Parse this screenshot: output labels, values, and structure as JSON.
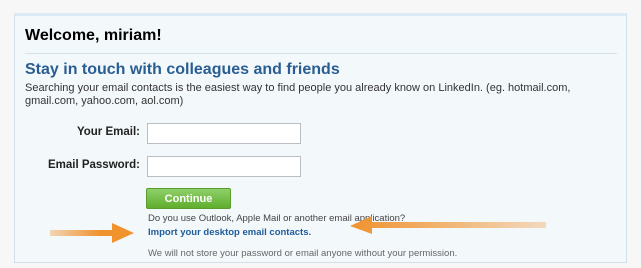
{
  "header": {
    "welcome": "Welcome, miriam!"
  },
  "intro": {
    "headline": "Stay in touch with colleagues and friends",
    "description": "Searching your email contacts is the easiest way to find people you already know on LinkedIn. (eg. hotmail.com, gmail.com, yahoo.com, aol.com)"
  },
  "form": {
    "email_label": "Your Email:",
    "email_value": "",
    "password_label": "Email Password:",
    "password_value": "",
    "continue_label": "Continue"
  },
  "help": {
    "question": "Do you use Outlook, Apple Mail or another email application?",
    "import_link": "Import your desktop email contacts.",
    "privacy_note": "We will not store your password or email anyone without your permission."
  },
  "colors": {
    "headline": "#2a5e93",
    "button": "#6cbf3a",
    "link": "#1f5c9a",
    "arrow": "#f0922e"
  },
  "icons": {
    "left_arrow": "arrow-right-icon",
    "right_arrow": "arrow-left-icon"
  }
}
